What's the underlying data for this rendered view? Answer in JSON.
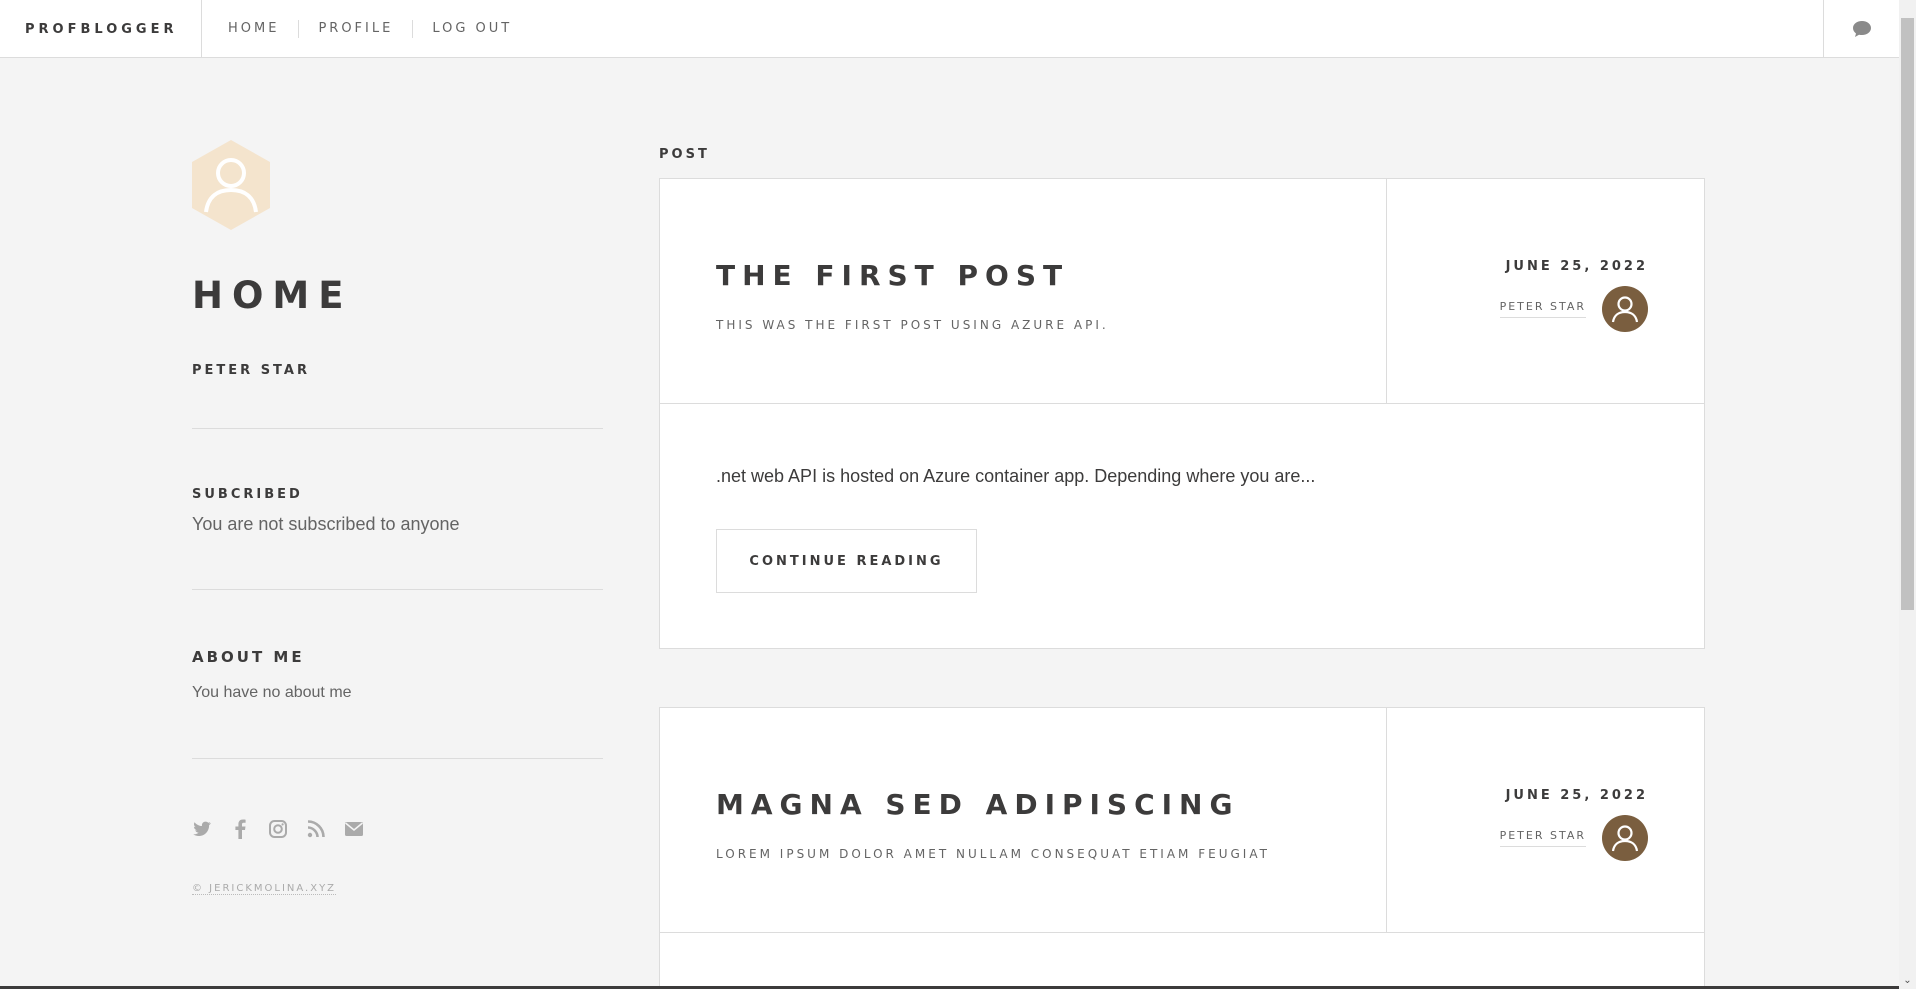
{
  "header": {
    "brand": "PROFBLOGGER",
    "nav": [
      "HOME",
      "PROFILE",
      "LOG OUT"
    ]
  },
  "sidebar": {
    "title": "HOME",
    "subtitle": "PETER STAR",
    "subscribed_label": "SUBCRIBED",
    "subscribed_text": "You are not subscribed to anyone",
    "about_label": "ABOUT ME",
    "about_text": "You have no about me",
    "copyright": "© JERICKMOLINA.XYZ"
  },
  "main": {
    "section_label": "POST",
    "posts": [
      {
        "title": "THE FIRST POST",
        "subtitle": "THIS WAS THE FIRST POST USING AZURE API.",
        "date": "JUNE 25, 2022",
        "author": "PETER STAR",
        "excerpt": ".net web API is hosted on Azure container app. Depending where you are...",
        "button": "CONTINUE READING"
      },
      {
        "title": "MAGNA SED ADIPISCING",
        "subtitle": "LOREM IPSUM DOLOR AMET NULLAM CONSEQUAT ETIAM FEUGIAT",
        "date": "JUNE 25, 2022",
        "author": "PETER STAR"
      }
    ]
  },
  "colors": {
    "accent_avatar": "#7a5e3f",
    "logo_hex": "#f4e4cd",
    "text_dark": "#3c3b3b",
    "background": "#f4f4f4"
  },
  "icons": [
    "user-icon",
    "chat-icon",
    "twitter-icon",
    "facebook-icon",
    "instagram-icon",
    "rss-icon",
    "envelope-icon"
  ]
}
